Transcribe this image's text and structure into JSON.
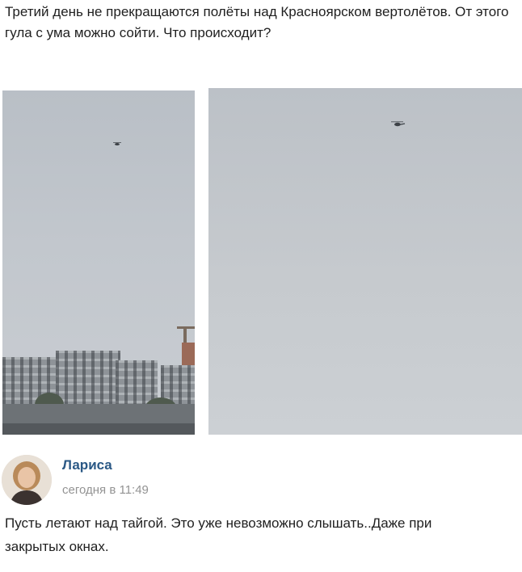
{
  "post": {
    "text": "Третий день не прекращаются полёты над Красноярском вертолётов. От этого гула с ума можно сойти. Что происходит?"
  },
  "comment": {
    "author": "Лариса",
    "time": "сегодня в 11:49",
    "text": "Пусть летают над тайгой. Это уже невозможно слышать..Даже при закрытых окнах."
  },
  "icons": [
    "helicopter-icon"
  ],
  "colors": {
    "author_link": "#2a5885",
    "timestamp": "#939393",
    "sky": "#c4c8cd"
  }
}
